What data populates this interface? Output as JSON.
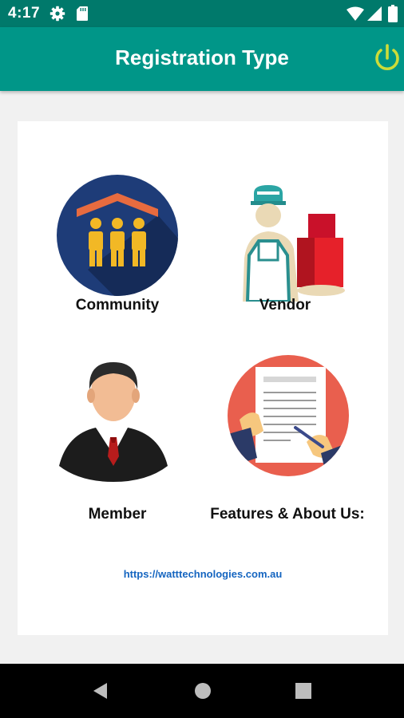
{
  "status_bar": {
    "time": "4:17",
    "icons": [
      "gear-icon",
      "sd-card-icon",
      "wifi-icon",
      "signal-icon",
      "battery-icon"
    ]
  },
  "app_bar": {
    "title": "Registration Type",
    "power_icon": "power-icon",
    "power_color": "#cddc39",
    "background": "#009688"
  },
  "options": [
    {
      "label": "Community",
      "icon": "community-icon"
    },
    {
      "label": "Vendor",
      "icon": "vendor-icon"
    },
    {
      "label": "Member",
      "icon": "member-icon"
    },
    {
      "label": "Features & About Us:",
      "icon": "document-signing-icon"
    }
  ],
  "footer_link": "https://watttechnologies.com.au",
  "nav_bar": {
    "icons": [
      "back-icon",
      "home-icon",
      "recents-icon"
    ]
  }
}
